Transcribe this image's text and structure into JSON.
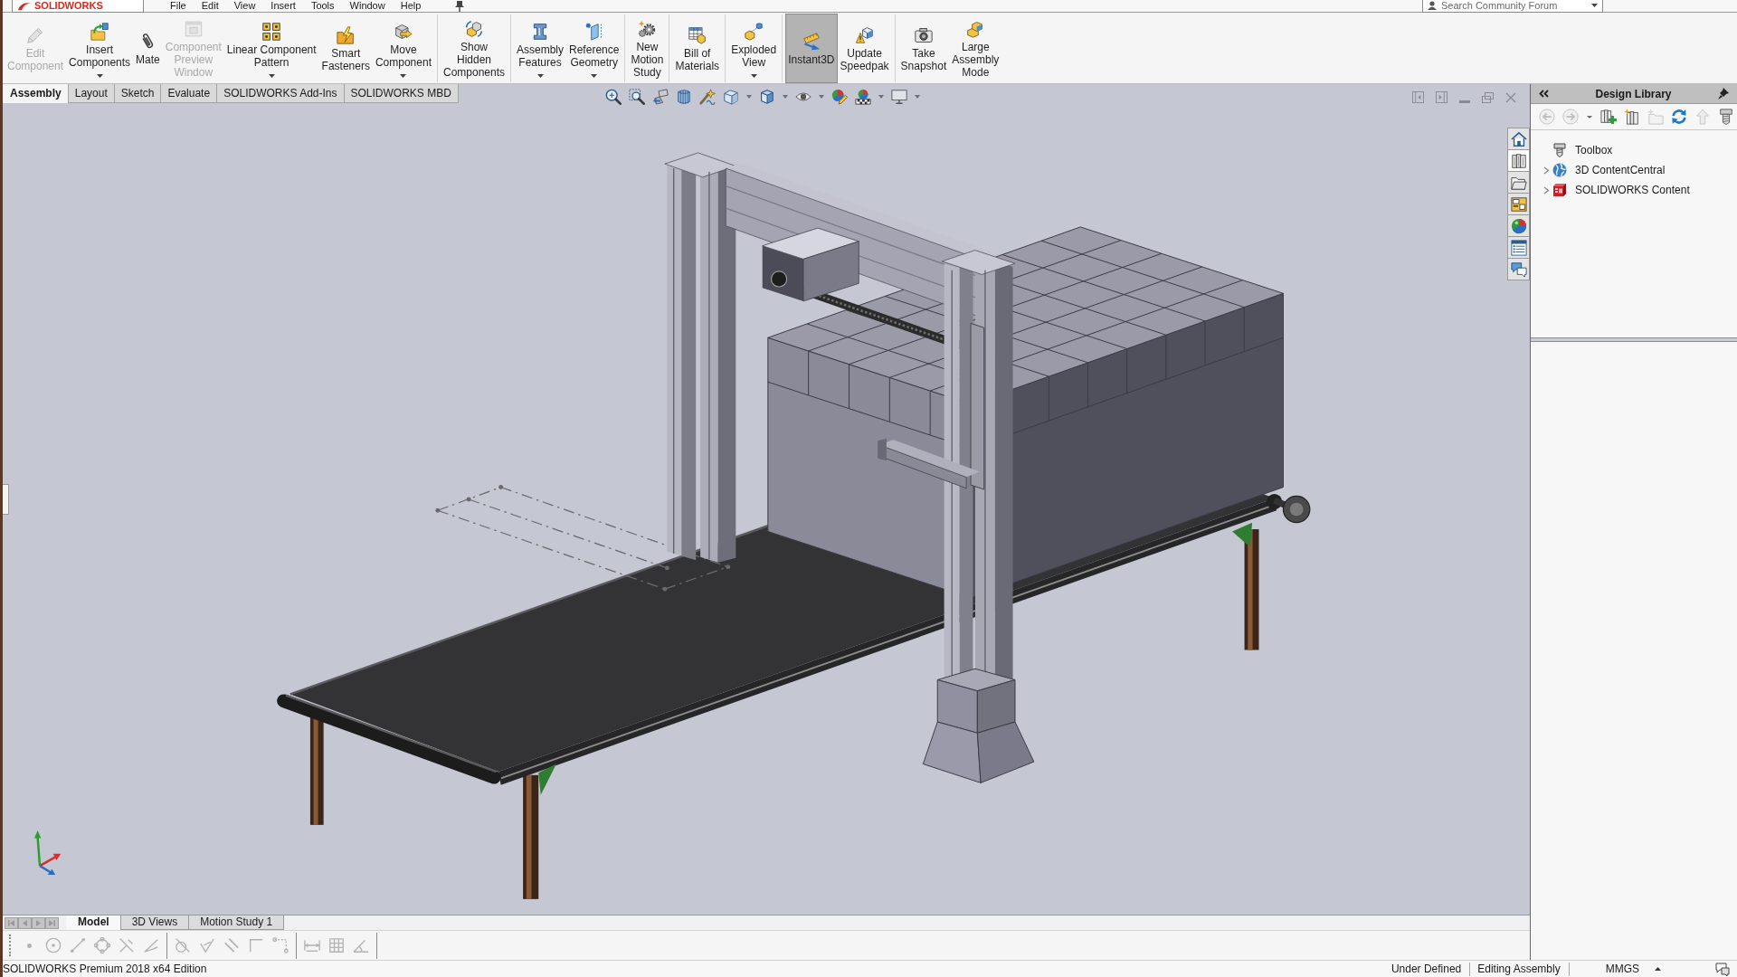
{
  "menu_bar": {
    "logo": "SOLIDWORKS",
    "items": [
      "File",
      "Edit",
      "View",
      "Insert",
      "Tools",
      "Window",
      "Help"
    ],
    "search": {
      "placeholder": "Search Community Forum"
    }
  },
  "command_manager": {
    "groups": [
      [
        {
          "kind": "edit-component",
          "label": "Edit\nComponent",
          "disabled": true,
          "dropdown": false,
          "on": false
        },
        {
          "kind": "insert-components",
          "label": "Insert\nComponents",
          "disabled": false,
          "dropdown": true,
          "on": false
        },
        {
          "kind": "mate",
          "label": "Mate",
          "disabled": false,
          "dropdown": false,
          "on": false
        },
        {
          "kind": "component-preview",
          "label": "Component\nPreview\nWindow",
          "disabled": true,
          "dropdown": false,
          "on": false
        },
        {
          "kind": "linear-pattern",
          "label": "Linear Component\nPattern",
          "disabled": false,
          "dropdown": true,
          "on": false
        },
        {
          "kind": "smart-fasteners",
          "label": "Smart\nFasteners",
          "disabled": false,
          "dropdown": false,
          "on": false
        },
        {
          "kind": "move-component",
          "label": "Move\nComponent",
          "disabled": false,
          "dropdown": true,
          "on": false
        }
      ],
      [
        {
          "kind": "show-hidden",
          "label": "Show\nHidden\nComponents",
          "disabled": false,
          "dropdown": false,
          "on": false
        }
      ],
      [
        {
          "kind": "assembly-features",
          "label": "Assembly\nFeatures",
          "disabled": false,
          "dropdown": true,
          "on": false
        },
        {
          "kind": "reference-geometry",
          "label": "Reference\nGeometry",
          "disabled": false,
          "dropdown": true,
          "on": false
        }
      ],
      [
        {
          "kind": "motion-study",
          "label": "New\nMotion\nStudy",
          "disabled": false,
          "dropdown": false,
          "on": false
        }
      ],
      [
        {
          "kind": "bill-of-materials",
          "label": "Bill of\nMaterials",
          "disabled": false,
          "dropdown": false,
          "on": false
        }
      ],
      [
        {
          "kind": "exploded-view",
          "label": "Exploded\nView",
          "disabled": false,
          "dropdown": true,
          "on": false
        }
      ],
      [
        {
          "kind": "instant3d",
          "label": "Instant3D",
          "disabled": false,
          "dropdown": false,
          "on": true
        },
        {
          "kind": "update-speedpak",
          "label": "Update\nSpeedpak",
          "disabled": false,
          "dropdown": false,
          "on": false
        }
      ],
      [
        {
          "kind": "take-snapshot",
          "label": "Take\nSnapshot",
          "disabled": false,
          "dropdown": false,
          "on": false
        },
        {
          "kind": "large-assembly-mode",
          "label": "Large\nAssembly\nMode",
          "disabled": false,
          "dropdown": false,
          "on": false
        }
      ]
    ]
  },
  "tabs": [
    {
      "label": "Assembly",
      "selected": true
    },
    {
      "label": "Layout",
      "selected": false
    },
    {
      "label": "Sketch",
      "selected": false
    },
    {
      "label": "Evaluate",
      "selected": false
    },
    {
      "label": "SOLIDWORKS Add-Ins",
      "selected": false
    },
    {
      "label": "SOLIDWORKS MBD",
      "selected": false
    }
  ],
  "view_toolbar": [
    {
      "kind": "zoom-fit",
      "dropdown": false
    },
    {
      "kind": "zoom-area",
      "dropdown": false
    },
    {
      "kind": "previous-view",
      "dropdown": false
    },
    {
      "kind": "section-view",
      "dropdown": false
    },
    {
      "kind": "dynamic-annotation",
      "dropdown": false
    },
    {
      "kind": "view-orientation",
      "dropdown": true
    },
    {
      "kind": "display-style",
      "dropdown": true
    },
    {
      "kind": "hide-show",
      "dropdown": true
    },
    {
      "kind": "edit-appearance",
      "dropdown": false
    },
    {
      "kind": "apply-scene",
      "dropdown": true
    },
    {
      "kind": "view-settings",
      "dropdown": true
    }
  ],
  "task_tabs": [
    {
      "kind": "home",
      "selected": false
    },
    {
      "kind": "design-library",
      "selected": true
    },
    {
      "kind": "file-explorer",
      "selected": false
    },
    {
      "kind": "view-palette",
      "selected": false
    },
    {
      "kind": "appearances",
      "selected": false
    },
    {
      "kind": "custom-properties",
      "selected": false
    },
    {
      "kind": "forum",
      "selected": false
    }
  ],
  "design_library": {
    "title": "Design Library",
    "toolbar": [
      {
        "kind": "back",
        "disabled": true
      },
      {
        "kind": "forward",
        "disabled": true
      },
      {
        "kind": "history",
        "disabled": false
      },
      {
        "kind": "add-to-library",
        "disabled": false
      },
      {
        "kind": "add-location",
        "disabled": false
      },
      {
        "kind": "new-folder",
        "disabled": true
      },
      {
        "kind": "refresh",
        "disabled": false
      },
      {
        "kind": "up",
        "disabled": true
      },
      {
        "kind": "toolbox",
        "disabled": false
      }
    ],
    "tree": [
      {
        "kind": "toolbox",
        "label": "Toolbox",
        "expandable": false,
        "expanded": false
      },
      {
        "kind": "content-central",
        "label": "3D ContentCentral",
        "expandable": true,
        "expanded": false
      },
      {
        "kind": "solidworks-content",
        "label": "SOLIDWORKS Content",
        "expandable": true,
        "expanded": false
      }
    ]
  },
  "bottom_tabs": [
    {
      "label": "Model",
      "selected": true
    },
    {
      "label": "3D Views",
      "selected": false
    },
    {
      "label": "Motion Study 1",
      "selected": false
    }
  ],
  "sketch_toolbar": {
    "groups": [
      [
        {
          "kind": "point",
          "disabled": true
        },
        {
          "kind": "circle",
          "disabled": true
        },
        {
          "kind": "line",
          "disabled": true
        },
        {
          "kind": "polygon-circle",
          "disabled": true
        },
        {
          "kind": "trim",
          "disabled": true
        },
        {
          "kind": "extend",
          "disabled": true
        }
      ],
      [
        {
          "kind": "fillet",
          "disabled": true
        },
        {
          "kind": "check",
          "disabled": true
        },
        {
          "kind": "offset",
          "disabled": true
        },
        {
          "kind": "corner",
          "disabled": true
        },
        {
          "kind": "dotted-rect",
          "disabled": true
        }
      ],
      [
        {
          "kind": "dimension",
          "disabled": true
        },
        {
          "kind": "grid",
          "disabled": true
        },
        {
          "kind": "angle",
          "disabled": true
        }
      ]
    ]
  },
  "status_bar": {
    "product": "SOLIDWORKS Premium 2018 x64 Edition",
    "sketch_state": "Under Defined",
    "mode": "Editing Assembly",
    "units": "MMGS"
  }
}
